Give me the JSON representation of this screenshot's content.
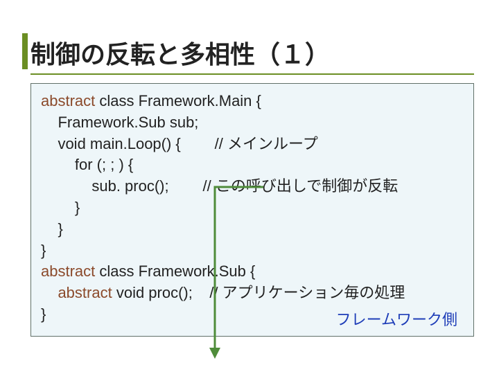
{
  "title": "制御の反転と多相性（１）",
  "code": {
    "l1_kw": "abstract",
    "l1_rest": " class Framework.Main {",
    "l2": "    Framework.Sub sub;",
    "l3_a": "    void main.Loop() {        ",
    "l3_cmt": "// メインループ",
    "l4": "        for (; ; ) {",
    "l5_a": "            sub. proc();        ",
    "l5_cmt": "// この呼び出しで制御が反転",
    "l6": "        }",
    "l7": "    }",
    "l8": "}",
    "l9_kw": "abstract",
    "l9_rest": " class Framework.Sub {",
    "l10_a_kw": "    abstract",
    "l10_a_rest": " void proc();    ",
    "l10_cmt": "// アプリケーション毎の処理",
    "l11": "}"
  },
  "label_framework": "フレームワーク側",
  "colors": {
    "accent": "#6b8e23",
    "box_bg": "#eef6f9",
    "box_border": "#607068",
    "keyword": "#8b4a2b",
    "link_blue": "#1e3db8",
    "arrow": "#4f8c3a"
  }
}
